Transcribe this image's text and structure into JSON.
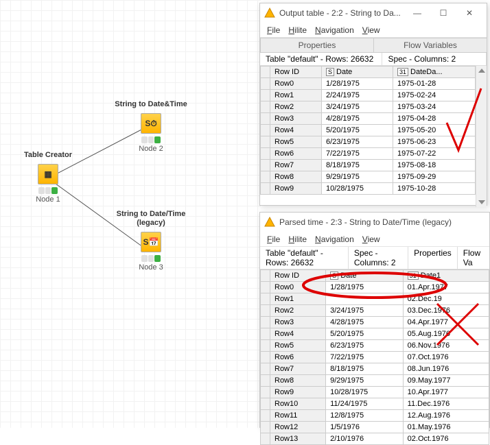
{
  "workflow": {
    "nodes": {
      "creator": {
        "title": "Table Creator",
        "name": "Node 1"
      },
      "str2dt": {
        "title": "String to Date&Time",
        "name": "Node 2"
      },
      "legacy": {
        "title": "String to Date/Time",
        "subtitle": "(legacy)",
        "name": "Node 3"
      }
    }
  },
  "win1": {
    "title": "Output table - 2:2 - String to Da...",
    "menu": [
      "File",
      "Hilite",
      "Navigation",
      "View"
    ],
    "tabs_top": [
      "Properties",
      "Flow Variables"
    ],
    "stats": "Table \"default\" - Rows: 26632",
    "spec": "Spec - Columns: 2",
    "cols": [
      "Row ID",
      "Date",
      "DateDa..."
    ],
    "col_icons": [
      "",
      "S",
      "31"
    ],
    "rows": [
      {
        "id": "Row0",
        "c1": "1/28/1975",
        "c2": "1975-01-28"
      },
      {
        "id": "Row1",
        "c1": "2/24/1975",
        "c2": "1975-02-24"
      },
      {
        "id": "Row2",
        "c1": "3/24/1975",
        "c2": "1975-03-24"
      },
      {
        "id": "Row3",
        "c1": "4/28/1975",
        "c2": "1975-04-28"
      },
      {
        "id": "Row4",
        "c1": "5/20/1975",
        "c2": "1975-05-20"
      },
      {
        "id": "Row5",
        "c1": "6/23/1975",
        "c2": "1975-06-23"
      },
      {
        "id": "Row6",
        "c1": "7/22/1975",
        "c2": "1975-07-22"
      },
      {
        "id": "Row7",
        "c1": "8/18/1975",
        "c2": "1975-08-18"
      },
      {
        "id": "Row8",
        "c1": "9/29/1975",
        "c2": "1975-09-29"
      },
      {
        "id": "Row9",
        "c1": "10/28/1975",
        "c2": "1975-10-28"
      }
    ]
  },
  "win2": {
    "title": "Parsed time - 2:3 - String to Date/Time (legacy)",
    "menu": [
      "File",
      "Hilite",
      "Navigation",
      "View"
    ],
    "stats": "Table \"default\" - Rows: 26632",
    "tabs": [
      "Spec - Columns: 2",
      "Properties",
      "Flow Va"
    ],
    "cols": [
      "Row ID",
      "Date",
      "Date1"
    ],
    "col_icons": [
      "",
      "S",
      "31"
    ],
    "rows": [
      {
        "id": "Row0",
        "c1": "1/28/1975",
        "c2": "01.Apr.1977"
      },
      {
        "id": "Row1",
        "c1": "",
        "c2": "02.Dec.19"
      },
      {
        "id": "Row2",
        "c1": "3/24/1975",
        "c2": "03.Dec.1976"
      },
      {
        "id": "Row3",
        "c1": "4/28/1975",
        "c2": "04.Apr.1977"
      },
      {
        "id": "Row4",
        "c1": "5/20/1975",
        "c2": "05.Aug.1976"
      },
      {
        "id": "Row5",
        "c1": "6/23/1975",
        "c2": "06.Nov.1976"
      },
      {
        "id": "Row6",
        "c1": "7/22/1975",
        "c2": "07.Oct.1976"
      },
      {
        "id": "Row7",
        "c1": "8/18/1975",
        "c2": "08.Jun.1976"
      },
      {
        "id": "Row8",
        "c1": "9/29/1975",
        "c2": "09.May.1977"
      },
      {
        "id": "Row9",
        "c1": "10/28/1975",
        "c2": "10.Apr.1977"
      },
      {
        "id": "Row10",
        "c1": "11/24/1975",
        "c2": "11.Dec.1976"
      },
      {
        "id": "Row11",
        "c1": "12/8/1975",
        "c2": "12.Aug.1976"
      },
      {
        "id": "Row12",
        "c1": "1/5/1976",
        "c2": "01.May.1976"
      },
      {
        "id": "Row13",
        "c1": "2/10/1976",
        "c2": "02.Oct.1976"
      }
    ]
  }
}
